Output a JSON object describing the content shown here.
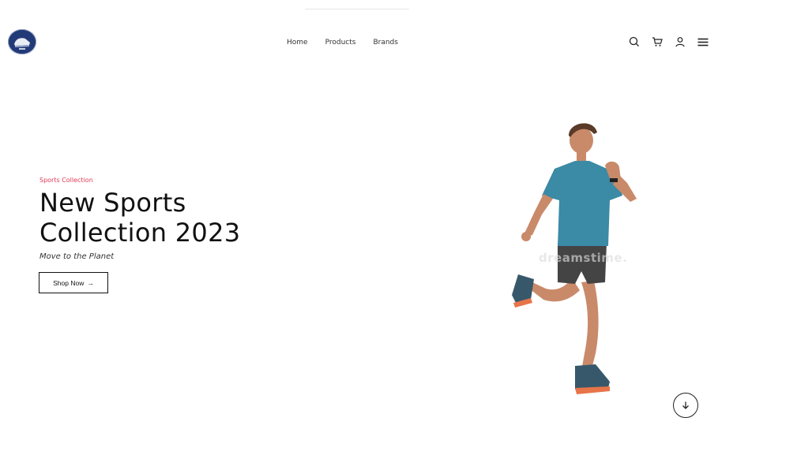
{
  "header": {
    "nav": [
      {
        "label": "Home"
      },
      {
        "label": "Products"
      },
      {
        "label": "Brands"
      }
    ],
    "icons": [
      "search-icon",
      "cart-icon",
      "user-icon",
      "menu-icon"
    ]
  },
  "hero": {
    "eyebrow": "Sports Collection",
    "title_line1": "New Sports",
    "title_line2": "Collection 2023",
    "tagline": "Move to the Planet",
    "cta_label": "Shop Now",
    "cta_arrow": "→",
    "image_watermark": "dreamstime."
  },
  "colors": {
    "accent": "#e33b57",
    "text": "#111111",
    "logo_bg": "#233a78",
    "shirt": "#3b8aa6",
    "shorts": "#444444"
  }
}
